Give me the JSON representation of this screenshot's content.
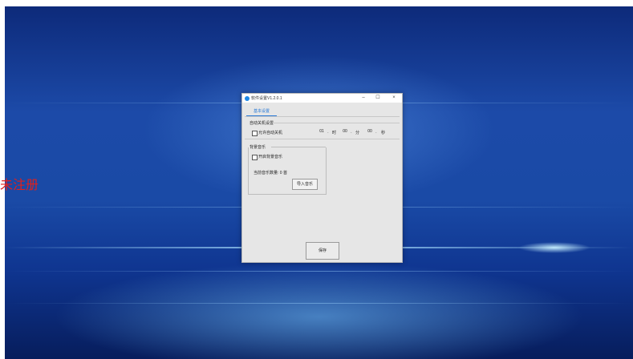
{
  "desktop": {
    "watermark": "未注册"
  },
  "window": {
    "title": "软件设置V1.2.0.1",
    "minimize": "–",
    "maximize": "☐",
    "close": "×",
    "tabs": [
      {
        "label": "基本设置",
        "active": true
      }
    ],
    "auto_shutdown": {
      "section_title": "自动关机设置",
      "checkbox_label": "允许自动关机",
      "checked": false,
      "hour": "01",
      "hour_unit": "时",
      "minute": "00",
      "minute_unit": "分",
      "second": "00",
      "second_unit": "秒"
    },
    "background_music": {
      "section_title": "背景音乐",
      "checkbox_label": "开启背景音乐",
      "checked": false,
      "count_text": "当前音乐数量: 0 首",
      "import_button": "导入音乐"
    },
    "save_button": "保存"
  },
  "colors": {
    "accent": "#2a7ad6",
    "watermark": "#e0201c",
    "desktop_bg": "#1c4aa8"
  }
}
